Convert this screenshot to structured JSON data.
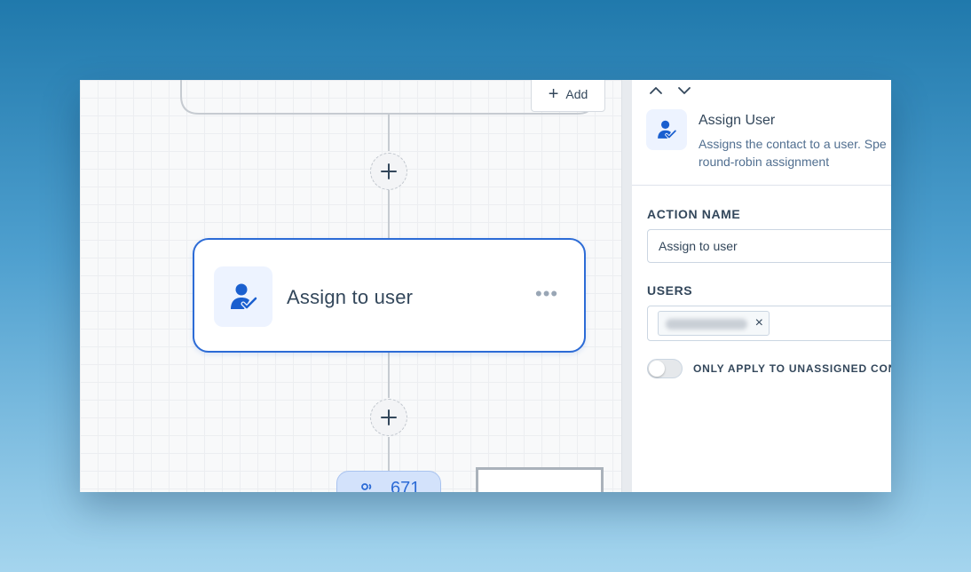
{
  "canvas": {
    "add_button_label": "Add",
    "node": {
      "title": "Assign to user",
      "more_label": "•••",
      "icon": "user-check-icon"
    },
    "count_pill_value": "671",
    "colors": {
      "accent": "#2c6bd6",
      "node_icon_bg": "#edf3ff"
    }
  },
  "panel": {
    "action_title": "Assign User",
    "action_description_line1": "Assigns the contact to a user. Spe",
    "action_description_line2": "round-robin assignment",
    "action_name_label": "ACTION NAME",
    "action_name_value": "Assign to user",
    "users_label": "USERS",
    "user_chip_remove": "×",
    "toggle_label": "ONLY APPLY TO UNASSIGNED CONT",
    "toggle_on": false
  }
}
